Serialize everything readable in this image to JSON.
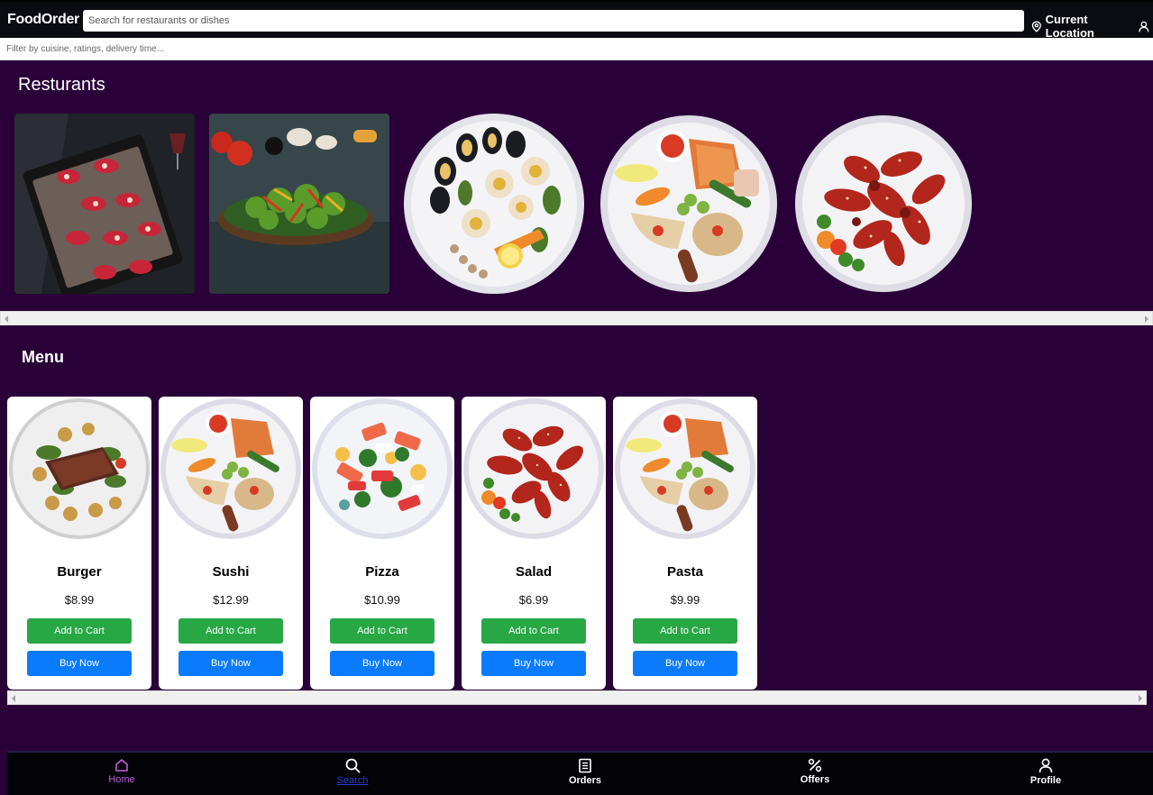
{
  "header": {
    "brand": "FoodOrder",
    "search_placeholder": "Search for restaurants or dishes",
    "location_label": "Current Location",
    "filter_placeholder": "Filter by cuisine, ratings, delivery time..."
  },
  "restaurants": {
    "title": "Resturants",
    "items": [
      {
        "name": "bruschetta-platter",
        "shape": "square"
      },
      {
        "name": "vegetable-salad-plate",
        "shape": "square"
      },
      {
        "name": "seafood-platter",
        "shape": "round"
      },
      {
        "name": "mixed-platter",
        "shape": "round"
      },
      {
        "name": "spicy-chicken-wings",
        "shape": "round"
      }
    ]
  },
  "menu": {
    "title": "Menu",
    "add_label": "Add to Cart",
    "buy_label": "Buy Now",
    "items": [
      {
        "name": "Burger",
        "price": "$8.99"
      },
      {
        "name": "Sushi",
        "price": "$12.99"
      },
      {
        "name": "Pizza",
        "price": "$10.99"
      },
      {
        "name": "Salad",
        "price": "$6.99"
      },
      {
        "name": "Pasta",
        "price": "$9.99"
      }
    ]
  },
  "bottom_nav": {
    "home": "Home",
    "search": "Search",
    "orders": "Orders",
    "offers": "Offers",
    "profile": "Profile"
  },
  "colors": {
    "background": "#2a0038",
    "add_to_cart": "#28a745",
    "buy_now": "#0a7bff",
    "active_nav": "#c15fe0"
  }
}
